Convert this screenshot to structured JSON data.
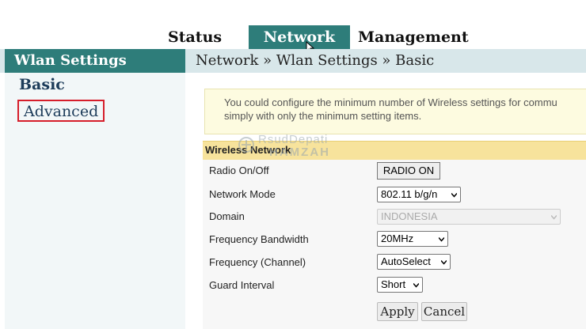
{
  "tabs": [
    {
      "label": "Status"
    },
    {
      "label": "Network"
    },
    {
      "label": "Management"
    }
  ],
  "sidebar": {
    "title": "Wlan Settings",
    "items": [
      {
        "label": "Basic"
      },
      {
        "label": "Advanced"
      }
    ]
  },
  "breadcrumb": "Network » Wlan Settings » Basic",
  "notice": {
    "line1": "You could configure the minimum number of Wireless settings for commu",
    "line2": "simply with only the minimum setting items."
  },
  "watermark": {
    "line1": "RsudDepati",
    "line2": "HAMZAH"
  },
  "section": {
    "title": "Wireless Network",
    "rows": [
      {
        "label": "Radio On/Off",
        "value": "RADIO ON"
      },
      {
        "label": "Network Mode",
        "value": "802.11 b/g/n"
      },
      {
        "label": "Domain",
        "value": "INDONESIA"
      },
      {
        "label": "Frequency Bandwidth",
        "value": "20MHz"
      },
      {
        "label": "Frequency (Channel)",
        "value": "AutoSelect"
      },
      {
        "label": "Guard Interval",
        "value": "Short"
      }
    ]
  },
  "actions": {
    "apply": "Apply",
    "cancel": "Cancel"
  },
  "colors": {
    "accent": "#2e7d7a",
    "section_header": "#f7e39c",
    "highlight": "#d61e2b"
  }
}
